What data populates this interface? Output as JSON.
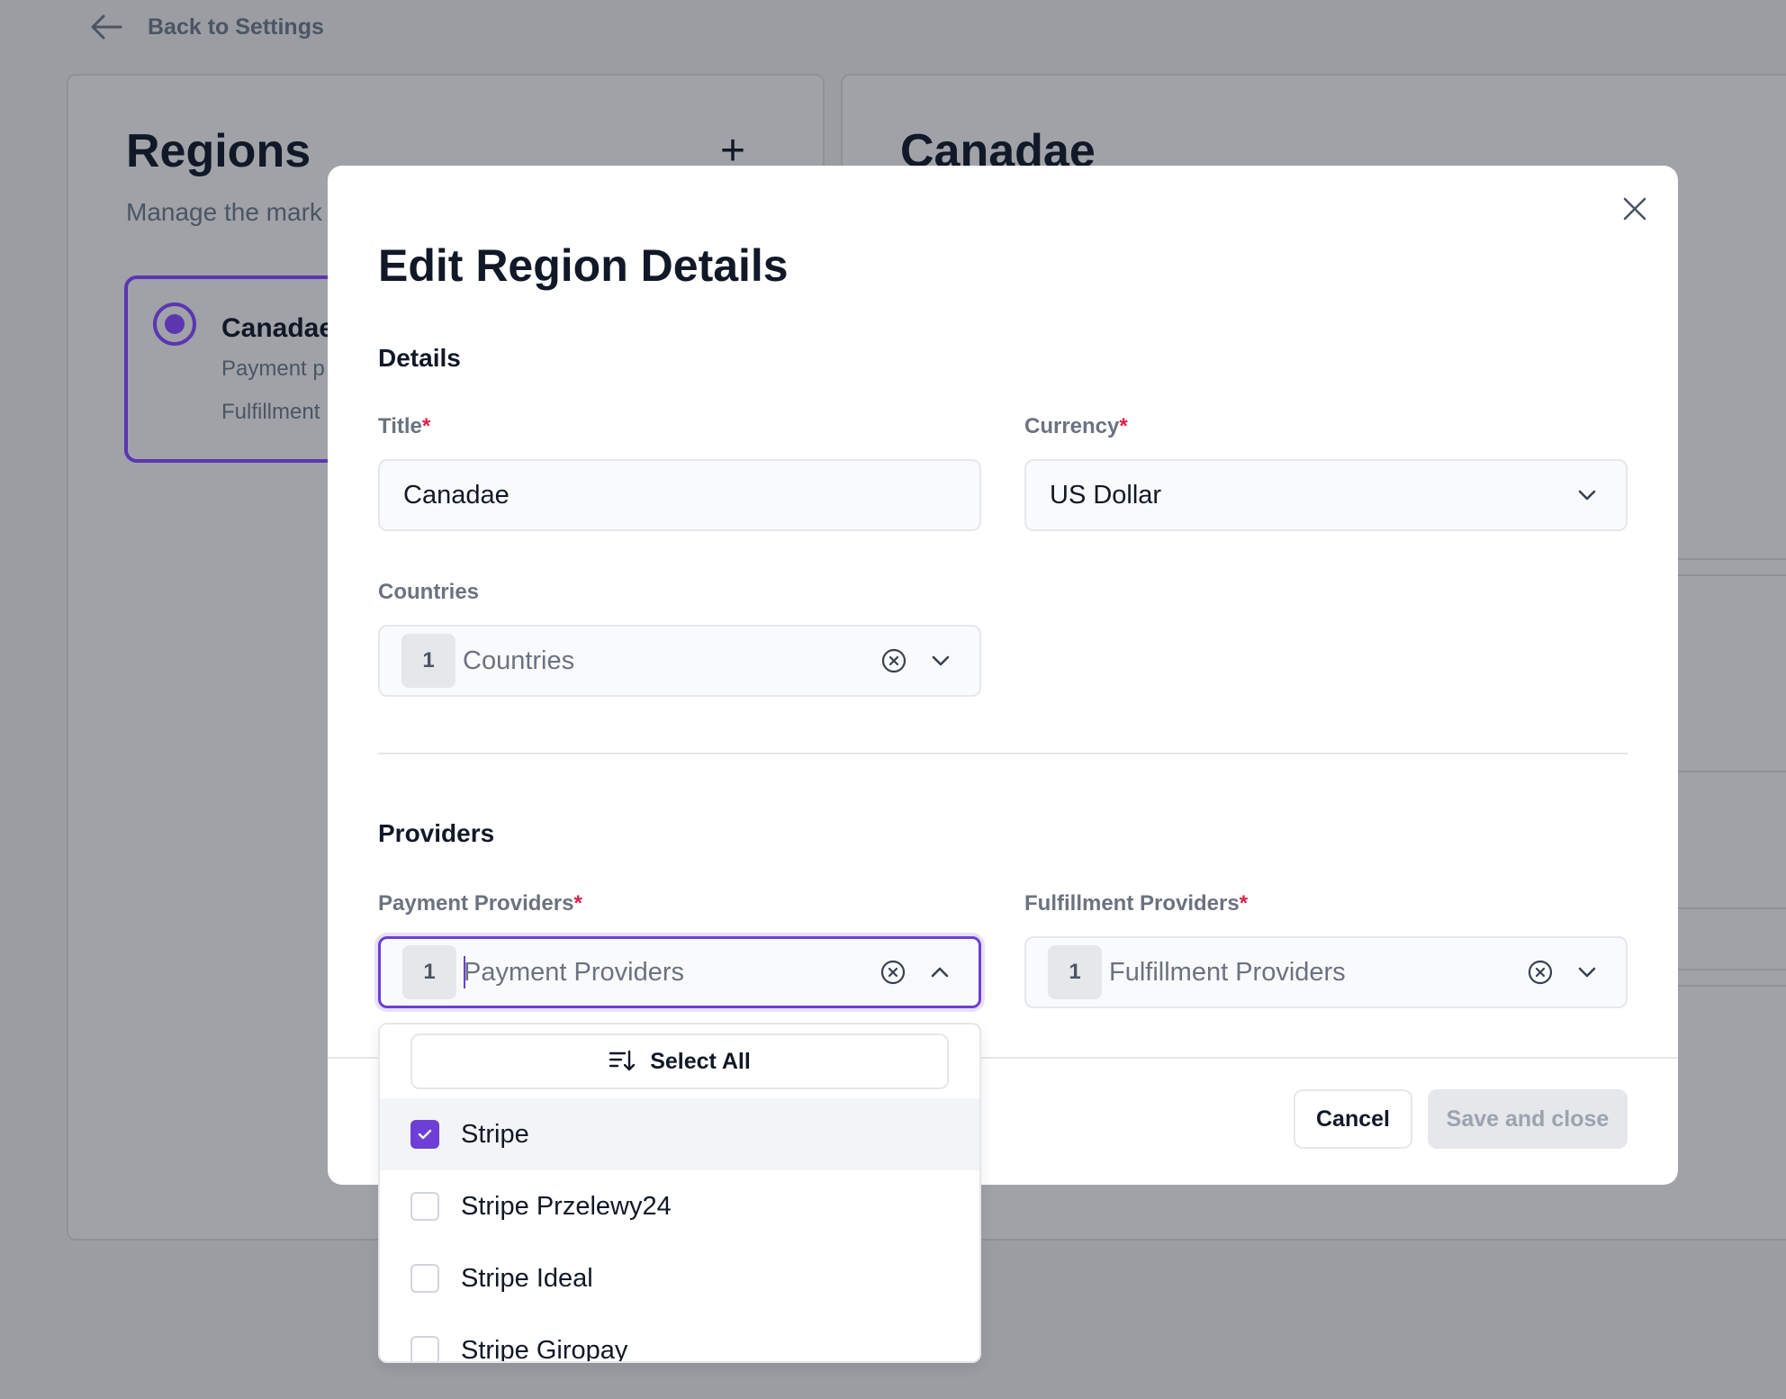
{
  "header": {
    "back_label": "Back to Settings"
  },
  "regions_panel": {
    "title": "Regions",
    "subtitle": "Manage the mark",
    "add_icon": "plus-icon",
    "selected_region": {
      "name": "Canadae",
      "payment_line": "Payment p",
      "fulfillment_line": "Fulfillment"
    }
  },
  "detail_panel": {
    "title": "Canadae"
  },
  "modal": {
    "title": "Edit Region Details",
    "close_icon": "close-icon",
    "details_heading": "Details",
    "title_field": {
      "label": "Title",
      "required_mark": "*",
      "value": "Canadae"
    },
    "currency_field": {
      "label": "Currency",
      "required_mark": "*",
      "value": "US Dollar"
    },
    "countries_field": {
      "label": "Countries",
      "count": "1",
      "placeholder": "Countries"
    },
    "providers_heading": "Providers",
    "payment_field": {
      "label": "Payment Providers",
      "required_mark": "*",
      "count": "1",
      "placeholder": "Payment Providers"
    },
    "fulfillment_field": {
      "label": "Fulfillment Providers",
      "required_mark": "*",
      "count": "1",
      "placeholder": "Fulfillment Providers"
    },
    "cancel_label": "Cancel",
    "save_label": "Save and close"
  },
  "payment_dropdown": {
    "select_all_label": "Select All",
    "options": [
      {
        "label": "Stripe",
        "checked": true
      },
      {
        "label": "Stripe Przelewy24",
        "checked": false
      },
      {
        "label": "Stripe Ideal",
        "checked": false
      },
      {
        "label": "Stripe Giropay",
        "checked": false
      }
    ]
  },
  "colors": {
    "accent": "#6d3fd6",
    "required": "#e11d48",
    "overlay": "#9b9da3"
  }
}
